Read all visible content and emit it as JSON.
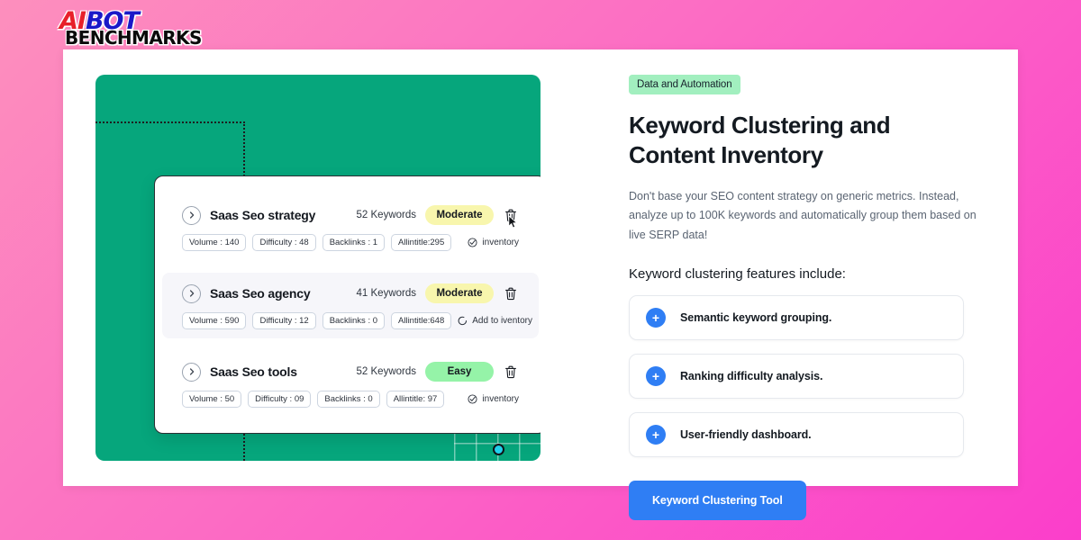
{
  "logo": {
    "part_ai": "AI",
    "part_bot": "BOT",
    "part_benchmarks": "BENCHMARKS",
    "color_ai": "#e8202a",
    "color_bot": "#1a18c8",
    "color_benchmarks": "#0a0a0a"
  },
  "background": {
    "gradient_from": "#fd8fbd",
    "gradient_to": "#fb3ecb"
  },
  "preview": {
    "panel_color": "#06a67c",
    "anchor_dot_color": "#22d3ee",
    "rows": [
      {
        "title": "Saas Seo strategy",
        "keywords": "52 Keywords",
        "badge": "Moderate",
        "badge_color": "#f8f6ad",
        "chips": [
          "Volume : 140",
          "Difficulty : 48",
          "Backlinks : 1",
          "Allintitle:295"
        ],
        "inventory_label": "inventory",
        "inventory_icon": "check-circle-icon",
        "highlight": false,
        "cursor_on_trash": true
      },
      {
        "title": "Saas Seo agency",
        "keywords": "41 Keywords",
        "badge": "Moderate",
        "badge_color": "#f8f6ad",
        "chips": [
          "Volume : 590",
          "Difficulty : 12",
          "Backlinks : 0",
          "Allintitle:648"
        ],
        "inventory_label": "Add to iventory",
        "inventory_icon": "refresh-circle-icon",
        "highlight": true,
        "cursor_on_trash": false
      },
      {
        "title": "Saas Seo tools",
        "keywords": "52 Keywords",
        "badge": "Easy",
        "badge_color": "#95f3a8",
        "chips": [
          "Volume : 50",
          "Difficulty : 09",
          "Backlinks : 0",
          "Allintitle: 97"
        ],
        "inventory_label": "inventory",
        "inventory_icon": "check-circle-icon",
        "highlight": false,
        "cursor_on_trash": false
      }
    ]
  },
  "content": {
    "tag": "Data and Automation",
    "tag_color": "#a2efbf",
    "headline": "Keyword Clustering and Content Inventory",
    "subcopy": "Don't base your SEO content strategy on generic metrics. Instead, analyze up to 100K keywords and automatically group them based on live SERP data!",
    "features_label": "Keyword clustering features include:",
    "features": [
      "Semantic keyword grouping.",
      "Ranking difficulty analysis.",
      "User-friendly dashboard."
    ],
    "cta_label": "Keyword Clustering Tool",
    "cta_color": "#2f7ef4"
  }
}
